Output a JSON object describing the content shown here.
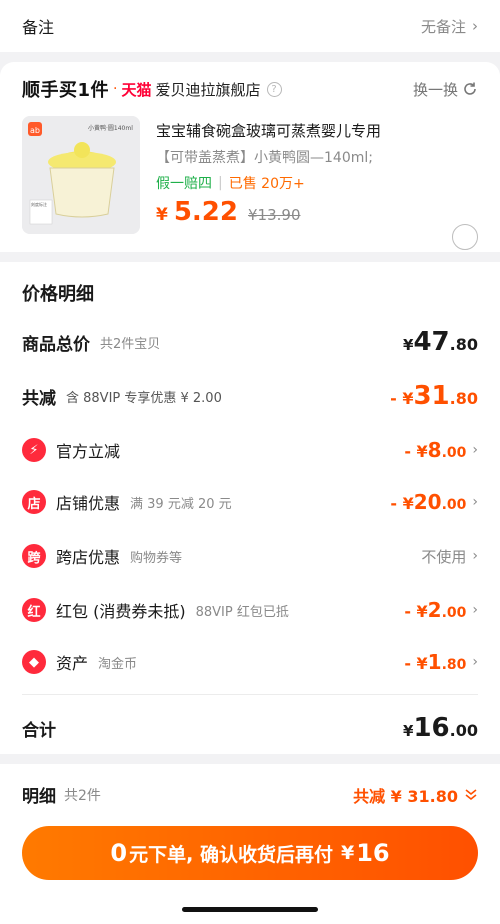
{
  "remark": {
    "label": "备注",
    "value": "无备注"
  },
  "shop": {
    "brand": "顺手买1件",
    "tmall": "天猫",
    "name": "爱贝迪拉旗舰店",
    "swap": "换一换"
  },
  "product": {
    "thumb_caption": "小黄鸭·圆140ml",
    "thumb_logo": "ab",
    "thumb_scale": "刻度标注",
    "title": "宝宝辅食碗盒玻璃可蒸煮婴儿专用",
    "spec": "【可带盖蒸煮】小黄鸭圆—140ml;",
    "tag1": "假一赔四",
    "tag2": "已售 20万+",
    "price_cur": "¥",
    "price": "5.22",
    "orig": "¥13.90"
  },
  "detail": {
    "title": "价格明细",
    "total": {
      "label": "商品总价",
      "sub": "共2件宝贝",
      "cur": "¥",
      "int": "47",
      "dec": ".80"
    },
    "reduce": {
      "label": "共减",
      "sub": "含 88VIP 专享优惠 ¥ 2.00",
      "cur": "- ¥",
      "int": "31",
      "dec": ".80"
    },
    "items": [
      {
        "icon": "⚡",
        "label": "官方立减",
        "sub": "",
        "cur": "- ¥",
        "int": "8",
        "dec": ".00"
      },
      {
        "icon": "店",
        "label": "店铺优惠",
        "sub": "满 39 元减 20 元",
        "cur": "- ¥",
        "int": "20",
        "dec": ".00"
      },
      {
        "icon": "跨",
        "label": "跨店优惠",
        "sub": "购物券等",
        "value": "不使用"
      },
      {
        "icon": "红",
        "label": "红包 (消费券未抵)",
        "sub": "88VIP 红包已抵",
        "cur": "- ¥",
        "int": "2",
        "dec": ".00"
      },
      {
        "icon": "◆",
        "label": "资产",
        "sub": "淘金币",
        "cur": "- ¥",
        "int": "1",
        "dec": ".80"
      }
    ],
    "sum": {
      "label": "合计",
      "cur": "¥",
      "int": "16",
      "dec": ".00"
    }
  },
  "bottom": {
    "label": "明细",
    "count": "共2件",
    "reduce": "共减 ¥ 31.80",
    "button_zero": "0",
    "button_text": "元下单, 确认收货后再付",
    "button_cur": "¥",
    "button_amt": "16"
  },
  "colors": {
    "accent": "#ff5000",
    "green": "#1fb04a",
    "red_icon": "#ff2a3c"
  }
}
